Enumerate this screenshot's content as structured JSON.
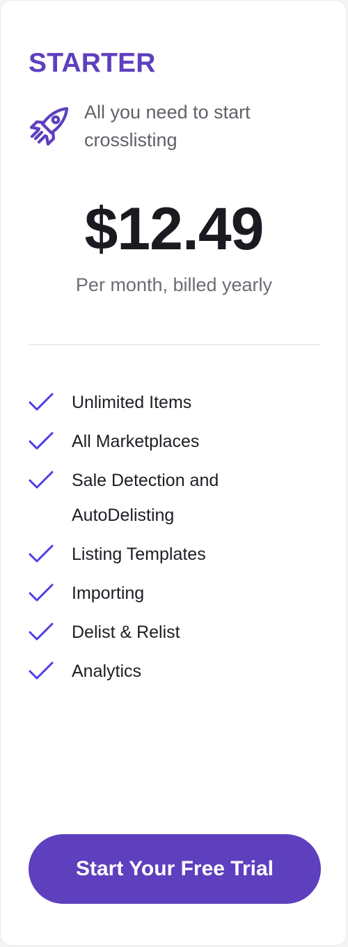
{
  "plan": {
    "name": "STARTER",
    "icon": "rocket-icon",
    "tagline": "All you need to start crosslisting",
    "price": "$12.49",
    "billing": "Per month, billed yearly"
  },
  "features": [
    "Unlimited Items",
    "All Marketplaces",
    "Sale Detection and AutoDelisting",
    "Listing Templates",
    "Importing",
    "Delist & Relist",
    "Analytics"
  ],
  "cta": {
    "label": "Start Your Free Trial"
  },
  "colors": {
    "accent": "#5e3fbe",
    "check": "#4d3ce6",
    "text": "#1d1e24",
    "muted": "#6b6d74"
  }
}
